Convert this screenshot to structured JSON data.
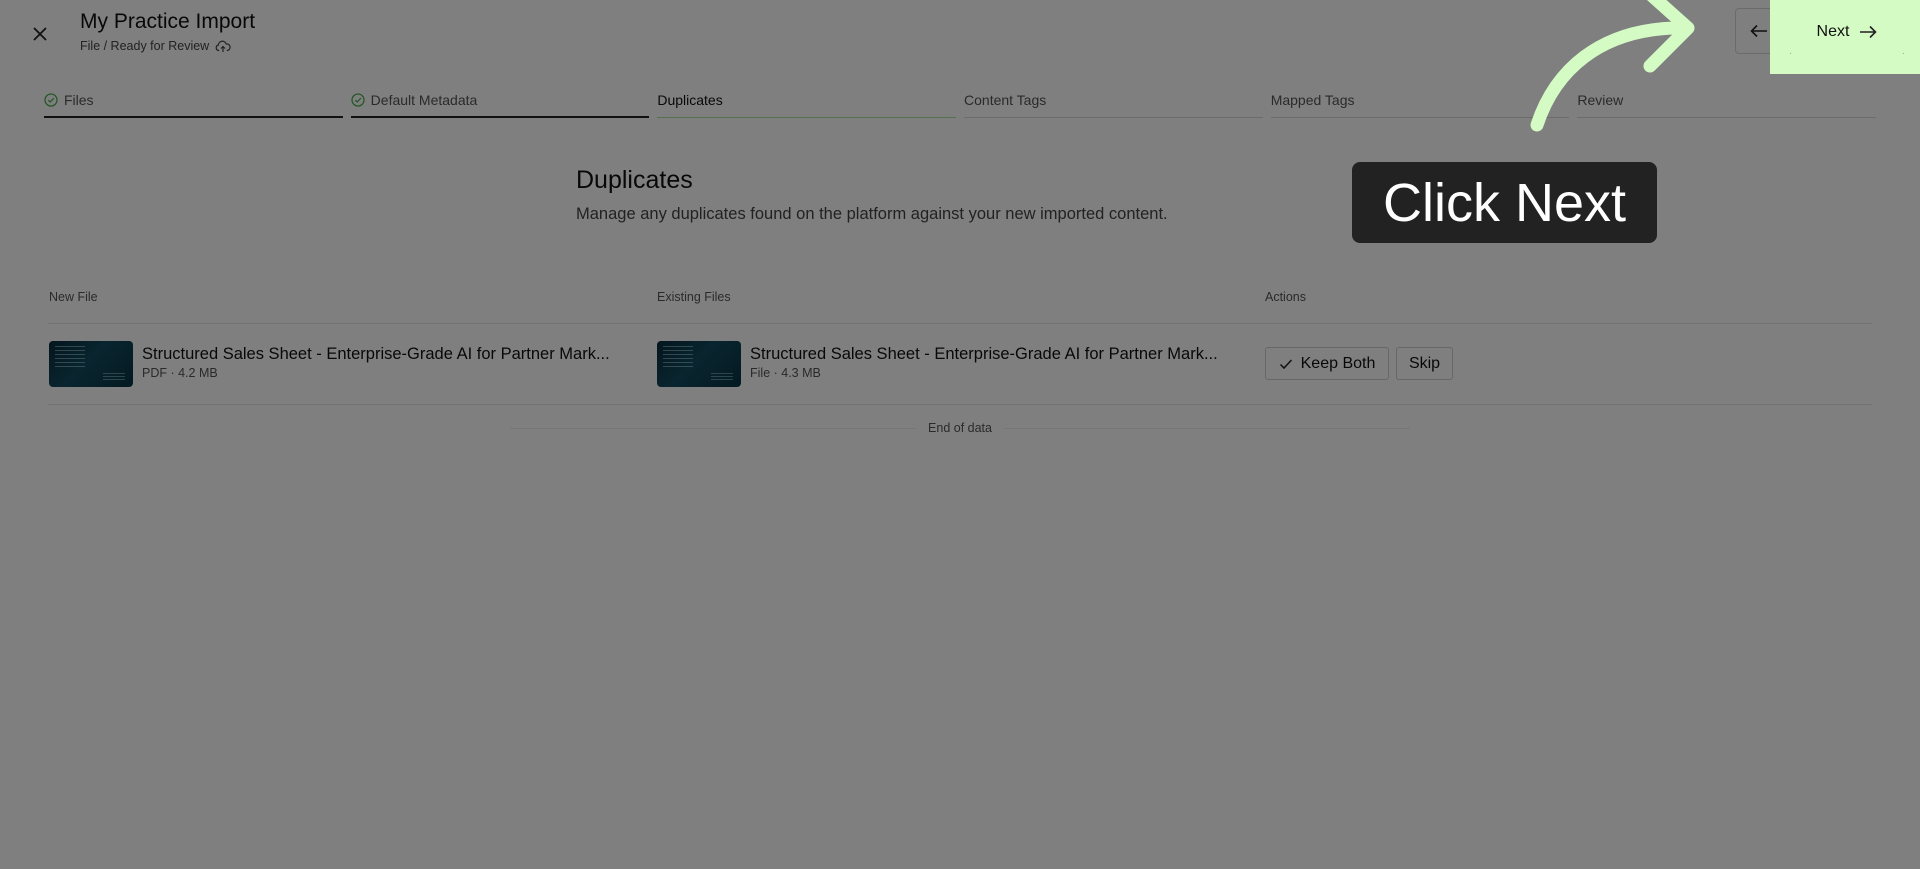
{
  "header": {
    "title": "My Practice Import",
    "subtitle": "File / Ready for Review"
  },
  "nav": {
    "next_label": "Next"
  },
  "steps": [
    {
      "label": "Files",
      "state": "done"
    },
    {
      "label": "Default Metadata",
      "state": "done"
    },
    {
      "label": "Duplicates",
      "state": "active"
    },
    {
      "label": "Content Tags",
      "state": "pending"
    },
    {
      "label": "Mapped Tags",
      "state": "pending"
    },
    {
      "label": "Review",
      "state": "pending"
    }
  ],
  "section": {
    "title": "Duplicates",
    "description": "Manage any duplicates found on the platform against your new imported content."
  },
  "table": {
    "columns": [
      "New File",
      "Existing Files",
      "Actions"
    ],
    "rows": [
      {
        "new_file": {
          "name": "Structured Sales Sheet - Enterprise-Grade AI for Partner Mark...",
          "meta": "PDF · 4.2 MB"
        },
        "existing_file": {
          "name": "Structured Sales Sheet - Enterprise-Grade AI for Partner Mark...",
          "meta": "File · 4.3 MB"
        },
        "actions": {
          "keep_both": "Keep Both",
          "skip": "Skip"
        }
      }
    ],
    "end_text": "End of data"
  },
  "overlay": {
    "callout_text": "Click Next",
    "highlight_color": "#d5fbc4",
    "dim_opacity": 0.5
  },
  "colors": {
    "accent": "#d5fbc4",
    "check": "#4caf50",
    "callout_bg": "#222222"
  }
}
